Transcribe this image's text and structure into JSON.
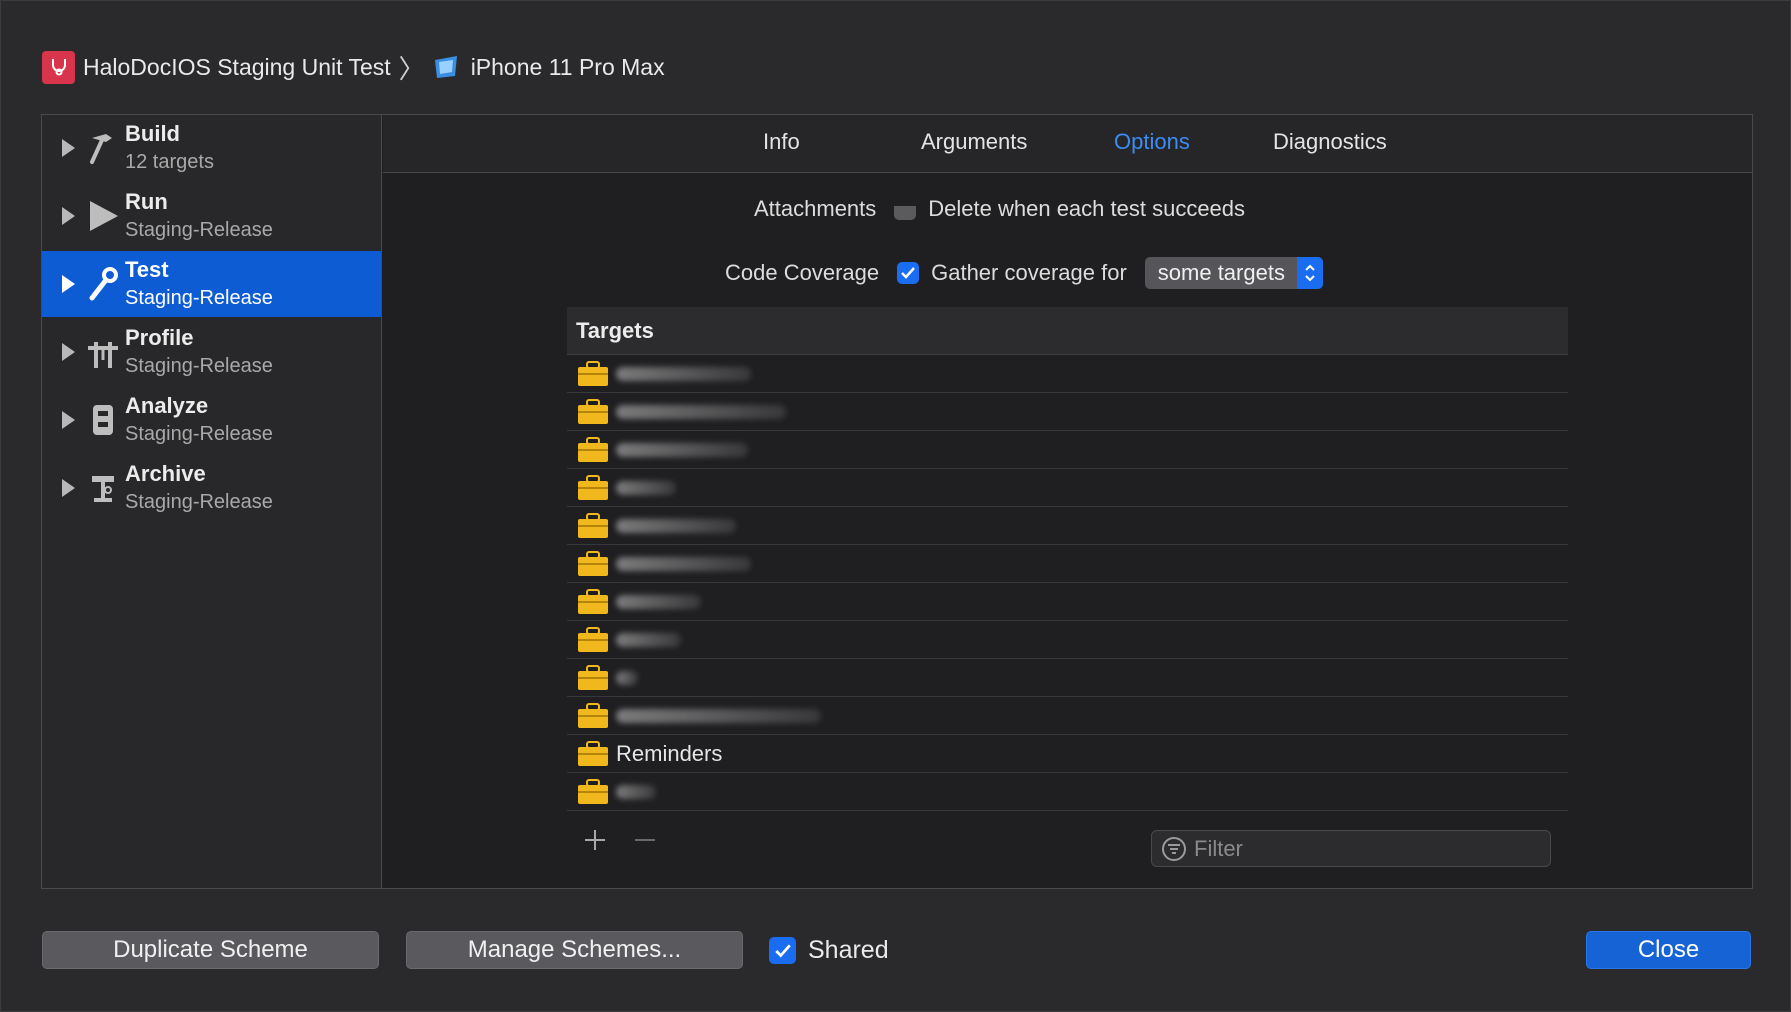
{
  "breadcrumb": {
    "scheme": "HaloDocIOS Staging Unit Test",
    "separator": "〉",
    "device": "iPhone 11 Pro Max"
  },
  "sidebar": {
    "items": [
      {
        "title": "Build",
        "subtitle": "12 targets",
        "icon": "hammer-icon",
        "selected": false
      },
      {
        "title": "Run",
        "subtitle": "Staging-Release",
        "icon": "play-icon",
        "selected": false
      },
      {
        "title": "Test",
        "subtitle": "Staging-Release",
        "icon": "wrench-icon",
        "selected": true
      },
      {
        "title": "Profile",
        "subtitle": "Staging-Release",
        "icon": "instruments-icon",
        "selected": false
      },
      {
        "title": "Analyze",
        "subtitle": "Staging-Release",
        "icon": "analyze-icon",
        "selected": false
      },
      {
        "title": "Archive",
        "subtitle": "Staging-Release",
        "icon": "archive-icon",
        "selected": false
      }
    ]
  },
  "tabs": [
    {
      "label": "Info",
      "active": false
    },
    {
      "label": "Arguments",
      "active": false
    },
    {
      "label": "Options",
      "active": true
    },
    {
      "label": "Diagnostics",
      "active": false
    }
  ],
  "options": {
    "attachments_label": "Attachments",
    "attachments_checkbox": "Delete when each test succeeds",
    "coverage_label": "Code Coverage",
    "coverage_checkbox": "Gather coverage for",
    "coverage_select": "some targets"
  },
  "targets": {
    "header": "Targets",
    "rows": [
      "",
      "",
      "",
      "",
      "",
      "",
      "",
      "",
      "",
      "",
      "Reminders",
      ""
    ]
  },
  "filter": {
    "placeholder": "Filter"
  },
  "bottom": {
    "duplicate": "Duplicate Scheme",
    "manage": "Manage Schemes...",
    "shared": "Shared",
    "close": "Close"
  },
  "colors": {
    "accent": "#1663d6",
    "selection": "#0e5cd3",
    "active_tab": "#3b8cf3",
    "target_icon": "#f1b81e",
    "app_icon": "#d8344b"
  }
}
